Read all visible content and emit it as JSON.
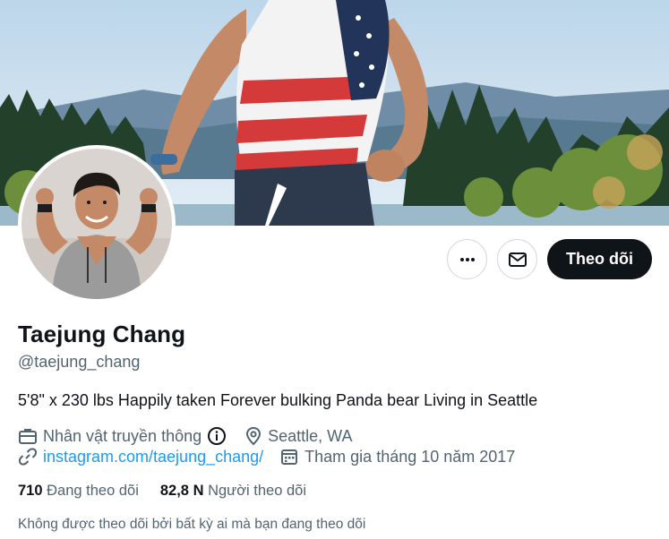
{
  "profile": {
    "display_name": "Taejung Chang",
    "handle": "@taejung_chang",
    "bio": "5'8\" x 230 lbs Happily taken Forever bulking Panda bear Living in Seattle",
    "category": "Nhân vật truyền thông",
    "location": "Seattle, WA",
    "website": "instagram.com/taejung_chang/",
    "joined": "Tham gia tháng 10 năm 2017"
  },
  "stats": {
    "following_count": "710",
    "following_label": "Đang theo dõi",
    "followers_count": "82,8 N",
    "followers_label": "Người theo dõi"
  },
  "actions": {
    "more_icon": "more-horizontal-icon",
    "message_icon": "envelope-icon",
    "follow_label": "Theo dõi"
  },
  "followed_by_note": "Không được theo dõi bởi bất kỳ ai mà bạn đang theo dõi",
  "icons": {
    "category": "briefcase-icon",
    "info": "info-icon",
    "location": "location-pin-icon",
    "link": "link-icon",
    "calendar": "calendar-icon"
  },
  "colors": {
    "text_primary": "#0f1419",
    "text_secondary": "#536471",
    "link": "#1d9bf0",
    "button_dark": "#0f1419",
    "border": "#cfd9de"
  }
}
